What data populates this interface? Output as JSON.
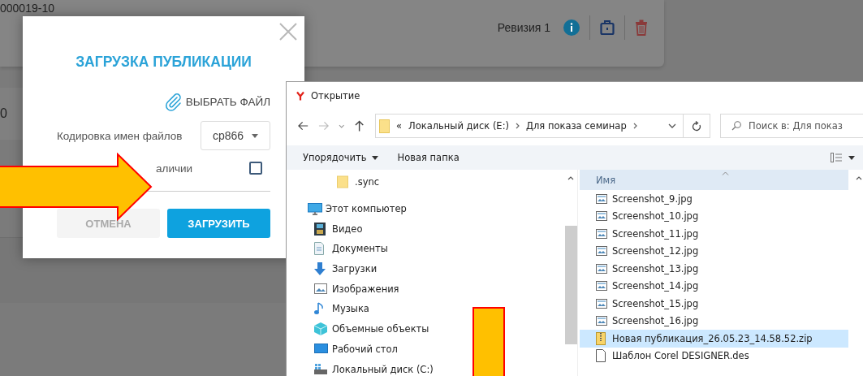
{
  "background_page": {
    "record_number": "000019-10",
    "row_fragment": "0",
    "revision": "Ревизия 1"
  },
  "upload_modal": {
    "title": "ЗАГРУЗКА ПУБЛИКАЦИИ",
    "choose_file": "ВЫБРАТЬ ФАЙЛ",
    "encoding_label": "Кодировка имен файлов",
    "encoding_value": "cp866",
    "option_label": "аличии",
    "option_checked": false,
    "buttons": [
      {
        "label": "ОТМЕНА",
        "kind": "secondary"
      },
      {
        "label": "ЗАГРУЗИТЬ",
        "kind": "primary"
      }
    ]
  },
  "file_dialog": {
    "title": "Открытие",
    "breadcrumb_overflow": "«",
    "breadcrumb": [
      "Локальный диск (E:)",
      "Для показа семинар"
    ],
    "search": {
      "placeholder": "Поиск в: Для показ"
    },
    "toolbar": [
      {
        "label": "Упорядочить",
        "has_menu": true
      },
      {
        "label": "Новая папка",
        "has_menu": false
      }
    ],
    "nav_tree": [
      {
        "label": ".sync",
        "kind": "folder"
      },
      {
        "label": "Этот компьютер",
        "kind": "computer",
        "children": [
          {
            "label": "Видео",
            "kind": "video"
          },
          {
            "label": "Документы",
            "kind": "documents"
          },
          {
            "label": "Загрузки",
            "kind": "downloads"
          },
          {
            "label": "Изображения",
            "kind": "pictures"
          },
          {
            "label": "Музыка",
            "kind": "music"
          },
          {
            "label": "Объемные объекты",
            "kind": "objects3d"
          },
          {
            "label": "Рабочий стол",
            "kind": "desktop"
          },
          {
            "label": "Локальный диск (C:)",
            "kind": "drive"
          }
        ]
      }
    ],
    "column_header": "Имя",
    "files": [
      {
        "name": "Screenshot_9.jpg",
        "kind": "image",
        "selected": false
      },
      {
        "name": "Screenshot_10.jpg",
        "kind": "image",
        "selected": false
      },
      {
        "name": "Screenshot_11.jpg",
        "kind": "image",
        "selected": false
      },
      {
        "name": "Screenshot_12.jpg",
        "kind": "image",
        "selected": false
      },
      {
        "name": "Screenshot_13.jpg",
        "kind": "image",
        "selected": false
      },
      {
        "name": "Screenshot_14.jpg",
        "kind": "image",
        "selected": false
      },
      {
        "name": "Screenshot_15.jpg",
        "kind": "image",
        "selected": false
      },
      {
        "name": "Screenshot_16.jpg",
        "kind": "image",
        "selected": false
      },
      {
        "name": "Новая публикация_26.05.23_14.58.52.zip",
        "kind": "zip",
        "selected": true
      },
      {
        "name": "Шаблон Corel DESIGNER.des",
        "kind": "document",
        "selected": false
      }
    ]
  }
}
